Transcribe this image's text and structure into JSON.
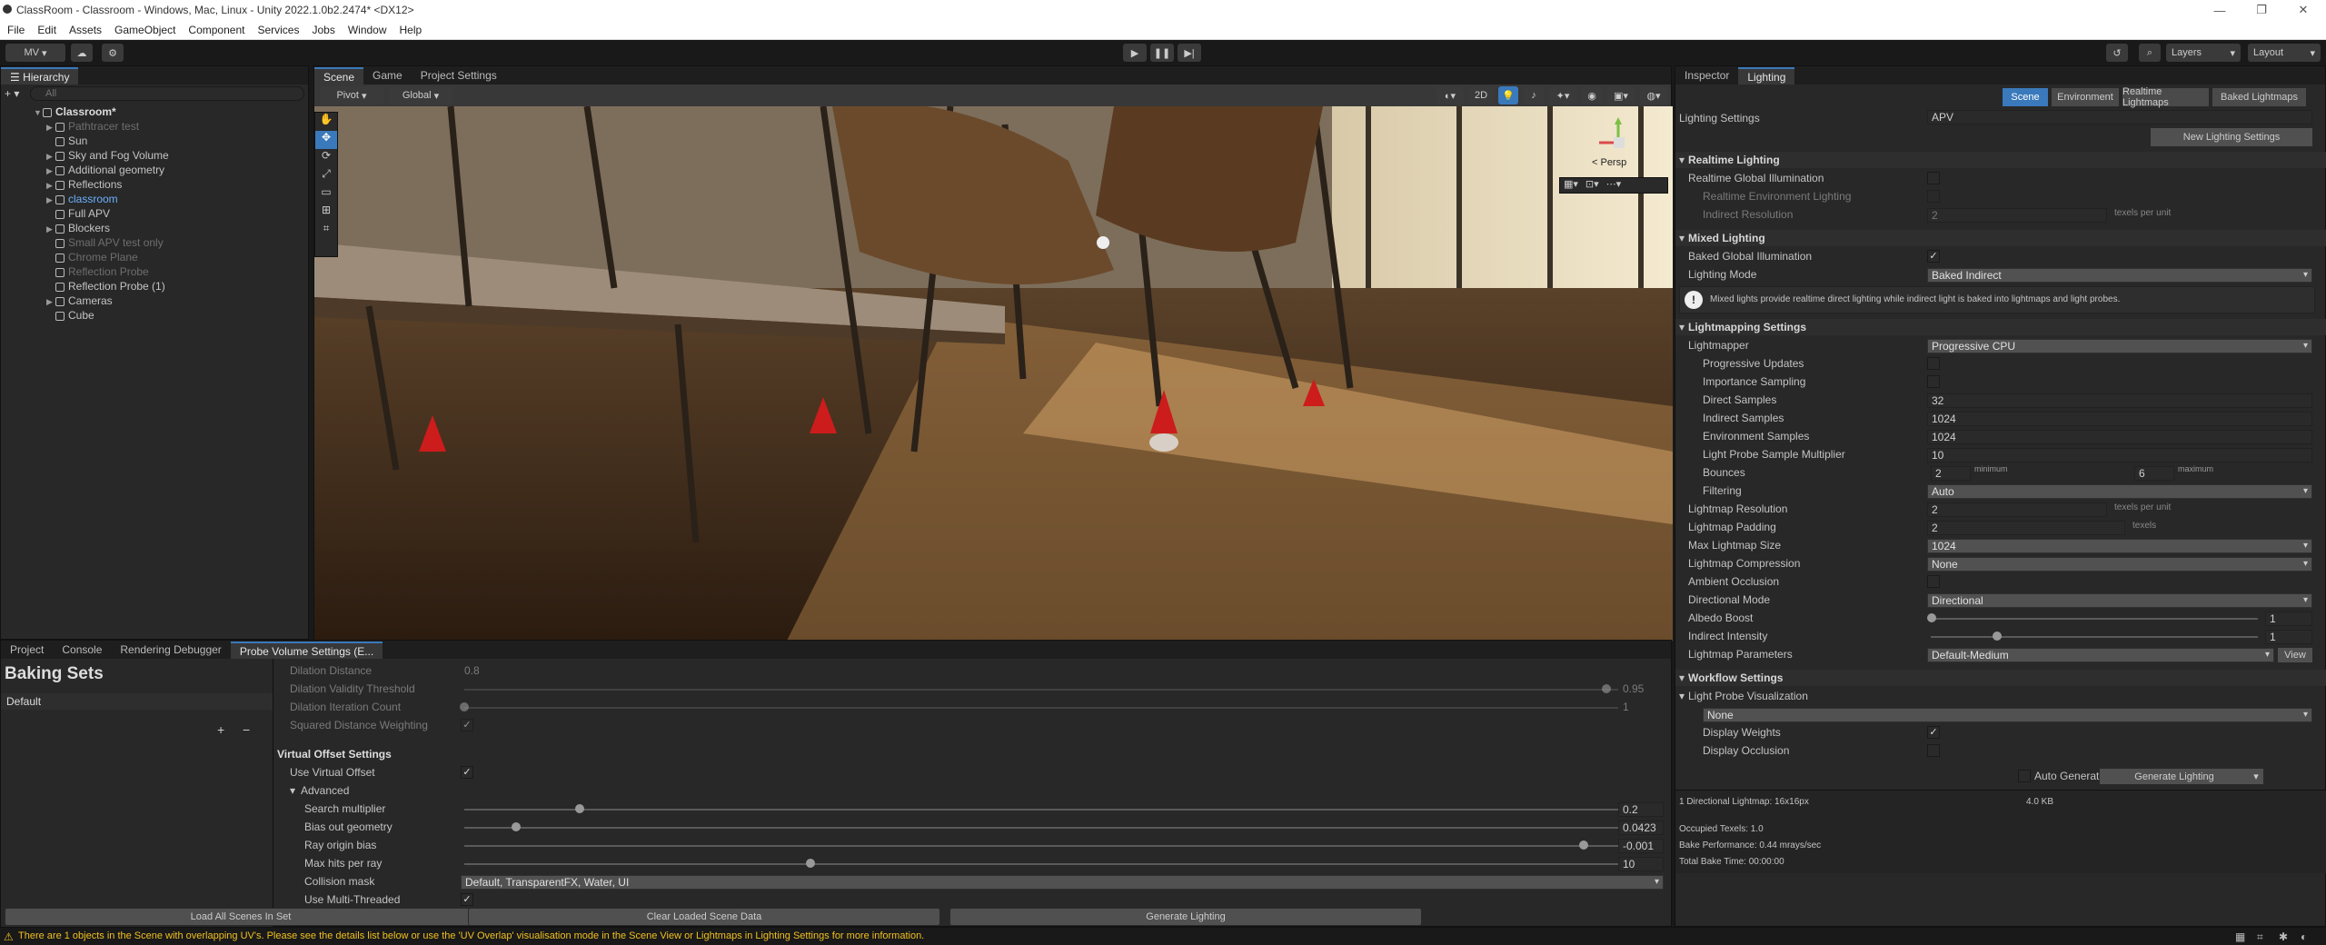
{
  "window": {
    "title": "ClassRoom - Classroom - Windows, Mac, Linux - Unity 2022.1.0b2.2474* <DX12>"
  },
  "menu": [
    "File",
    "Edit",
    "Assets",
    "GameObject",
    "Component",
    "Services",
    "Jobs",
    "Window",
    "Help"
  ],
  "toolbar": {
    "account": "MV",
    "layers": "Layers",
    "layout": "Layout"
  },
  "hierarchy": {
    "tab": "Hierarchy",
    "search_placeholder": "All",
    "root": "Classroom*",
    "items": [
      {
        "label": "Pathtracer test",
        "dim": true,
        "arrow": true
      },
      {
        "label": "Sun",
        "dim": false,
        "arrow": false
      },
      {
        "label": "Sky and Fog Volume",
        "dim": false,
        "arrow": true
      },
      {
        "label": "Additional geometry",
        "dim": false,
        "arrow": true
      },
      {
        "label": "Reflections",
        "dim": false,
        "arrow": true
      },
      {
        "label": "classroom",
        "dim": false,
        "arrow": true,
        "blue": true
      },
      {
        "label": "Full APV",
        "dim": false,
        "arrow": false
      },
      {
        "label": "Blockers",
        "dim": false,
        "arrow": true
      },
      {
        "label": "Small APV test only",
        "dim": true,
        "arrow": false
      },
      {
        "label": "Chrome Plane",
        "dim": true,
        "arrow": false
      },
      {
        "label": "Reflection Probe",
        "dim": true,
        "arrow": false
      },
      {
        "label": "Reflection Probe (1)",
        "dim": false,
        "arrow": false
      },
      {
        "label": "Cameras",
        "dim": false,
        "arrow": true
      },
      {
        "label": "Cube",
        "dim": false,
        "arrow": false
      }
    ]
  },
  "scene": {
    "tabs": [
      "Scene",
      "Game",
      "Project Settings"
    ],
    "pivot": "Pivot",
    "global": "Global",
    "btn_2d": "2D",
    "persp": "< Persp"
  },
  "inspector": {
    "tabs": [
      "Inspector",
      "Lighting"
    ],
    "subtabs": [
      "Scene",
      "Environment",
      "Realtime Lightmaps",
      "Baked Lightmaps"
    ],
    "lighting_settings_label": "Lighting Settings",
    "lighting_settings_value": "APV",
    "new_btn": "New Lighting Settings",
    "realtime": {
      "title": "Realtime Lighting",
      "rgi": "Realtime Global Illumination",
      "rel": "Realtime Environment Lighting",
      "ir": "Indirect Resolution",
      "ir_val": "2",
      "ir_unit": "texels per unit"
    },
    "mixed": {
      "title": "Mixed Lighting",
      "bgi": "Baked Global Illumination",
      "mode": "Lighting Mode",
      "mode_val": "Baked Indirect",
      "info": "Mixed lights provide realtime direct lighting while indirect light is baked into lightmaps and light probes."
    },
    "lm": {
      "title": "Lightmapping Settings",
      "rows": [
        {
          "label": "Lightmapper",
          "value": "Progressive CPU",
          "type": "dd",
          "indent": 0
        },
        {
          "label": "Progressive Updates",
          "value": "",
          "type": "cb",
          "indent": 1
        },
        {
          "label": "Importance Sampling",
          "value": "",
          "type": "cb",
          "indent": 1
        },
        {
          "label": "Direct Samples",
          "value": "32",
          "type": "field",
          "indent": 1
        },
        {
          "label": "Indirect Samples",
          "value": "1024",
          "type": "field",
          "indent": 1
        },
        {
          "label": "Environment Samples",
          "value": "1024",
          "type": "field",
          "indent": 1
        },
        {
          "label": "Light Probe Sample Multiplier",
          "value": "10",
          "type": "field",
          "indent": 1
        }
      ],
      "bounces": "Bounces",
      "bmin": "2",
      "bmin_l": "minimum",
      "bmax": "6",
      "bmax_l": "maximum",
      "filtering": "Filtering",
      "filtering_val": "Auto",
      "res": "Lightmap Resolution",
      "res_val": "2",
      "res_unit": "texels per unit",
      "pad": "Lightmap Padding",
      "pad_val": "2",
      "pad_unit": "texels",
      "max": "Max Lightmap Size",
      "max_val": "1024",
      "comp": "Lightmap Compression",
      "comp_val": "None",
      "ao": "Ambient Occlusion",
      "dir": "Directional Mode",
      "dir_val": "Directional",
      "albedo": "Albedo Boost",
      "albedo_val": "1",
      "ind": "Indirect Intensity",
      "ind_val": "1",
      "params": "Lightmap Parameters",
      "params_val": "Default-Medium",
      "view": "View"
    },
    "wf": {
      "title": "Workflow Settings",
      "lpv": "Light Probe Visualization",
      "lpv_val": "None",
      "dw": "Display Weights",
      "do": "Display Occlusion"
    },
    "auto": "Auto Generate",
    "gen": "Generate Lighting",
    "stats": {
      "l1": "1 Directional Lightmap: 16x16px",
      "l1b": "4.0 KB",
      "l2": "Occupied Texels: 1.0",
      "l3": "Bake Performance: 0.44 mrays/sec",
      "l4": "Total Bake Time: 00:00:00"
    }
  },
  "bottom": {
    "tabs": [
      "Project",
      "Console",
      "Rendering Debugger",
      "Probe Volume Settings (E..."
    ],
    "baking_sets": "Baking Sets",
    "default_set": "Default",
    "dil": [
      {
        "label": "Dilation Distance",
        "val": "0.8"
      },
      {
        "label": "Dilation Validity Threshold",
        "val": "0.95",
        "slider": 0.99
      },
      {
        "label": "Dilation Iteration Count",
        "val": "1",
        "slider": 0.0
      },
      {
        "label": "Squared Distance Weighting",
        "val": "",
        "check": true
      }
    ],
    "vo_title": "Virtual Offset Settings",
    "use_vo": "Use Virtual Offset",
    "advanced": "Advanced",
    "sliders": [
      {
        "label": "Search multiplier",
        "val": "0.2",
        "f": 0.1
      },
      {
        "label": "Bias out geometry",
        "val": "0.0423",
        "f": 0.045
      },
      {
        "label": "Ray origin bias",
        "val": "-0.001",
        "f": 0.97
      },
      {
        "label": "Max hits per ray",
        "val": "10",
        "f": 0.3
      }
    ],
    "collision": "Collision mask",
    "collision_val": "Default, TransparentFX, Water, UI",
    "multi": "Use Multi-Threaded",
    "btns": [
      "Load All Scenes In Set",
      "Clear Loaded Scene Data",
      "Generate Lighting"
    ]
  },
  "status": "There are 1 objects in the Scene with overlapping UV's. Please see the details list below or use the 'UV Overlap' visualisation mode in the Scene View or Lightmaps in Lighting Settings for more information."
}
